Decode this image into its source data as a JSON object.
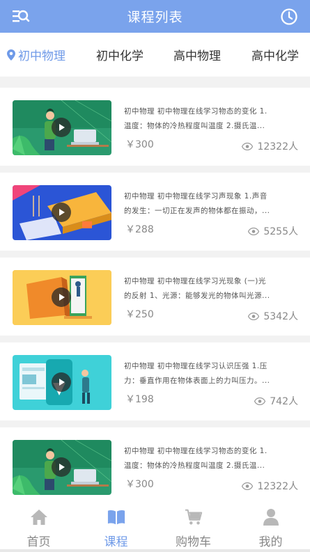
{
  "header": {
    "title": "课程列表",
    "left_icon": "search-list-icon",
    "right_icon": "clock-icon"
  },
  "tabs": [
    {
      "label": "初中物理",
      "active": true
    },
    {
      "label": "初中化学",
      "active": false
    },
    {
      "label": "高中物理",
      "active": false
    },
    {
      "label": "高中化学",
      "active": false
    }
  ],
  "courses": [
    {
      "line1": "初中物理  初中物理在线学习物态的变化 1.",
      "line2": "温度：物体的冷热程度叫温度 2.摄氏温...",
      "price": "￥300",
      "views": "12322人",
      "thumb": "green"
    },
    {
      "line1": "初中物理  初中物理在线学习声现象 1.声音",
      "line2": "的发生：一切正在发声的物体都在振动，...",
      "price": "￥288",
      "views": "5255人",
      "thumb": "blue"
    },
    {
      "line1": "初中物理  初中物理在线学习光现象 (一)光",
      "line2": "的反射 1、光源：能够发光的物体叫光源...",
      "price": "￥250",
      "views": "5342人",
      "thumb": "orange"
    },
    {
      "line1": "初中物理  初中物理在线学习认识压强 1.压",
      "line2": "力：垂直作用在物体表面上的力叫压力。...",
      "price": "￥198",
      "views": "742人",
      "thumb": "teal"
    },
    {
      "line1": "初中物理  初中物理在线学习物态的变化 1.",
      "line2": "温度：物体的冷热程度叫温度 2.摄氏温...",
      "price": "￥300",
      "views": "12322人",
      "thumb": "green"
    }
  ],
  "bottom_nav": [
    {
      "label": "首页",
      "icon": "home-icon",
      "active": false
    },
    {
      "label": "课程",
      "icon": "book-icon",
      "active": true
    },
    {
      "label": "购物车",
      "icon": "cart-icon",
      "active": false
    },
    {
      "label": "我的",
      "icon": "user-icon",
      "active": false
    }
  ],
  "colors": {
    "header_bg": "#7aa3ec",
    "accent": "#6f9ae8",
    "text_gray": "#888888"
  }
}
